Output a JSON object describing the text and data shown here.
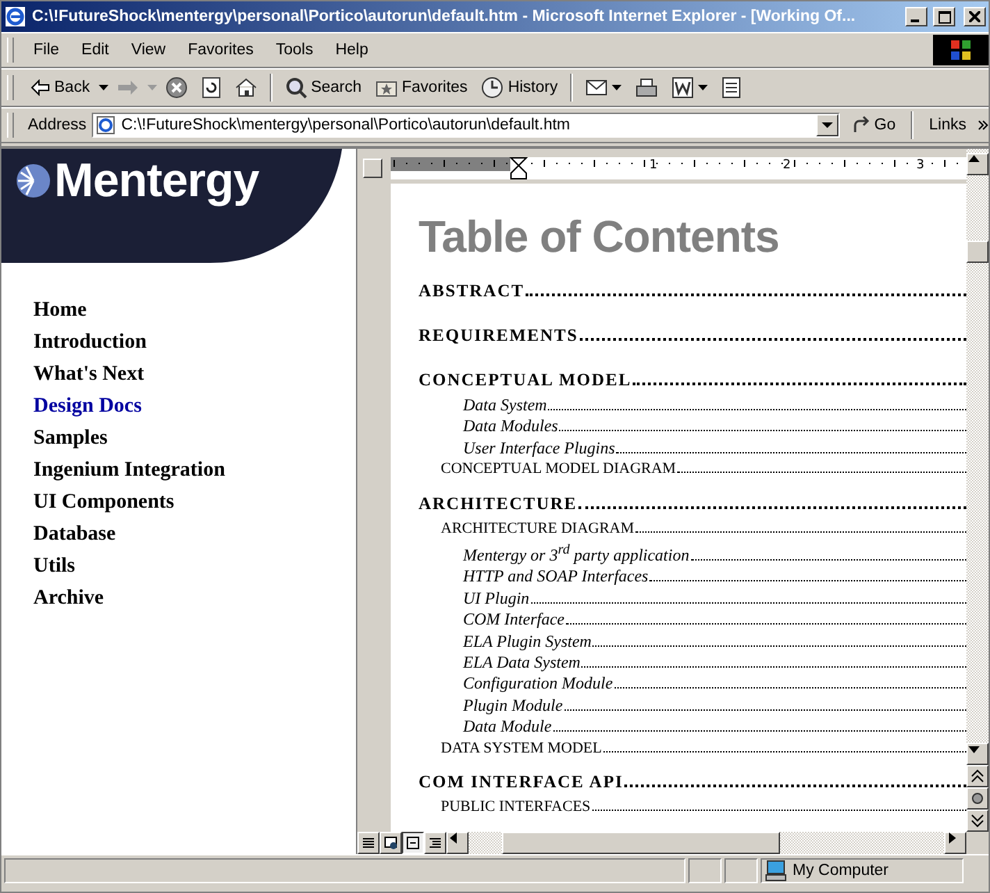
{
  "window": {
    "title": "C:\\!FutureShock\\mentergy\\personal\\Portico\\autorun\\default.htm - Microsoft Internet Explorer - [Working Of..."
  },
  "menu": [
    "File",
    "Edit",
    "View",
    "Favorites",
    "Tools",
    "Help"
  ],
  "toolbar": {
    "back": "Back",
    "search": "Search",
    "favorites": "Favorites",
    "history": "History"
  },
  "address": {
    "label": "Address",
    "value": "C:\\!FutureShock\\mentergy\\personal\\Portico\\autorun\\default.htm",
    "go": "Go",
    "links": "Links"
  },
  "sidebar": {
    "logo": "Mentergy",
    "items": [
      {
        "label": "Home",
        "selected": false
      },
      {
        "label": "Introduction",
        "selected": false
      },
      {
        "label": "What's Next",
        "selected": false
      },
      {
        "label": "Design Docs",
        "selected": true
      },
      {
        "label": "Samples",
        "selected": false
      },
      {
        "label": "Ingenium Integration",
        "selected": false
      },
      {
        "label": "UI Components",
        "selected": false
      },
      {
        "label": "Database",
        "selected": false
      },
      {
        "label": "Utils",
        "selected": false
      },
      {
        "label": "Archive",
        "selected": false
      }
    ]
  },
  "ruler": [
    "1",
    "2",
    "3"
  ],
  "document": {
    "title": "Table of Contents",
    "entries": [
      {
        "kind": "h1",
        "text": "ABSTRACT"
      },
      {
        "kind": "h1",
        "text": "REQUIREMENTS"
      },
      {
        "kind": "h1",
        "text": "CONCEPTUAL MODEL"
      },
      {
        "kind": "h3",
        "text": "Data System"
      },
      {
        "kind": "h3",
        "text": "Data Modules"
      },
      {
        "kind": "h3",
        "text": "User Interface Plugins"
      },
      {
        "kind": "h2",
        "text": "CONCEPTUAL MODEL DIAGRAM"
      },
      {
        "kind": "h1",
        "text": "ARCHITECTURE"
      },
      {
        "kind": "h2",
        "text": "ARCHITECTURE DIAGRAM"
      },
      {
        "kind": "h3",
        "text": "Mentergy or 3$^{rd}$ party application"
      },
      {
        "kind": "h3",
        "text": "HTTP and SOAP Interfaces"
      },
      {
        "kind": "h3",
        "text": "UI Plugin"
      },
      {
        "kind": "h3",
        "text": "COM Interface"
      },
      {
        "kind": "h3",
        "text": "ELA Plugin System"
      },
      {
        "kind": "h3",
        "text": "ELA Data System"
      },
      {
        "kind": "h3",
        "text": "Configuration Module"
      },
      {
        "kind": "h3",
        "text": "Plugin Module"
      },
      {
        "kind": "h3",
        "text": "Data Module"
      },
      {
        "kind": "h2",
        "text": "DATA SYSTEM MODEL"
      },
      {
        "kind": "h1",
        "text": "COM INTERFACE API"
      },
      {
        "kind": "h2",
        "text": "PUBLIC INTERFACES"
      }
    ]
  },
  "status_bar": {
    "zone": "My Computer"
  }
}
